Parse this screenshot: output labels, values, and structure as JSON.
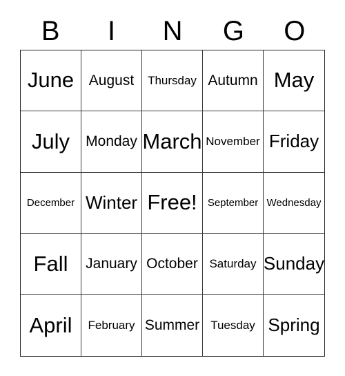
{
  "card": {
    "title": "BINGO",
    "header_letters": [
      "B",
      "I",
      "N",
      "G",
      "O"
    ],
    "colors": {
      "background": "#ffffff",
      "text": "#000000",
      "grid_line": "#3a3a3a",
      "outer_border": "#222222"
    },
    "rows": [
      [
        {
          "label": "June",
          "size": "len-xl"
        },
        {
          "label": "August",
          "size": "len-md"
        },
        {
          "label": "Thursday",
          "size": "len-sm"
        },
        {
          "label": "Autumn",
          "size": "len-md"
        },
        {
          "label": "May",
          "size": "len-xl"
        }
      ],
      [
        {
          "label": "July",
          "size": "len-xl"
        },
        {
          "label": "Monday",
          "size": "len-md"
        },
        {
          "label": "March",
          "size": "len-xl"
        },
        {
          "label": "November",
          "size": "len-sm"
        },
        {
          "label": "Friday",
          "size": "len-lg"
        }
      ],
      [
        {
          "label": "December",
          "size": "len-xs"
        },
        {
          "label": "Winter",
          "size": "len-lg"
        },
        {
          "label": "Free!",
          "size": "len-xl"
        },
        {
          "label": "September",
          "size": "len-xs"
        },
        {
          "label": "Wednesday",
          "size": "len-xs"
        }
      ],
      [
        {
          "label": "Fall",
          "size": "len-xl"
        },
        {
          "label": "January",
          "size": "len-md"
        },
        {
          "label": "October",
          "size": "len-md"
        },
        {
          "label": "Saturday",
          "size": "len-sm"
        },
        {
          "label": "Sunday",
          "size": "len-lg"
        }
      ],
      [
        {
          "label": "April",
          "size": "len-xl"
        },
        {
          "label": "February",
          "size": "len-sm"
        },
        {
          "label": "Summer",
          "size": "len-md"
        },
        {
          "label": "Tuesday",
          "size": "len-sm"
        },
        {
          "label": "Spring",
          "size": "len-lg"
        }
      ]
    ]
  }
}
